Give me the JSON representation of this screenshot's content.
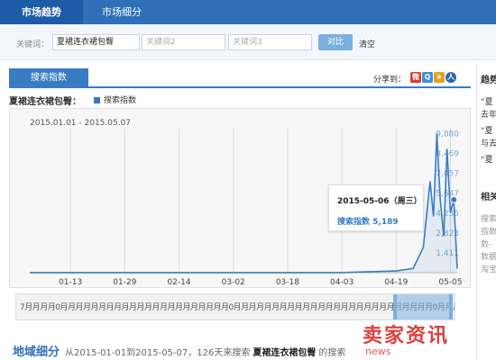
{
  "nav": {
    "tabs": [
      {
        "label": "市场趋势"
      },
      {
        "label": "市场细分"
      }
    ]
  },
  "keywords": {
    "label": "关键词：",
    "kw1_value": "夏裙连衣裙包臀",
    "kw2_placeholder": "关键词2",
    "kw3_placeholder": "关键词3",
    "compare_label": "对比",
    "clear_label": "清空"
  },
  "panel": {
    "tab_label": "搜索指数",
    "share_label": "分享到："
  },
  "chart_header": {
    "title": "夏裙连衣裙包臀：",
    "legend": "搜索指数",
    "date_range": "2015.01.01 - 2015.05.07"
  },
  "tooltip": {
    "date": "2015-05-06（周三）",
    "label_value": "搜索指数 5,189"
  },
  "navigator": {
    "cells": "7月月月月0月月月月月月月月月月月月月月月月月月月月月月0月月月月月月月月月月月月月月月月月月月月月月月月月月0月月月月月月月"
  },
  "bottom": {
    "heading": "地域细分",
    "prefix": "从2015-01-01到2015-05-07，126天来搜索",
    "keyword": "夏裙连衣裙包臀",
    "suffix": "的搜索"
  },
  "watermark": {
    "main": "卖家资讯",
    "sub": "news"
  },
  "sidebar": {
    "t1": "趋势",
    "s1": "“夏",
    "s2": "去年",
    "s3": "“夏",
    "s4": "与去",
    "s5": "“夏",
    "t2": "相关",
    "g1": "搜索",
    "g2": "指数",
    "g3": "数-",
    "g4": "数据",
    "g5": "淘宝"
  },
  "chart_data": {
    "type": "line",
    "yticks": [
      "1,411",
      "2,823",
      "4,235",
      "5,647",
      "7,057",
      "8,469",
      "9,880"
    ],
    "xticks": [
      "01-13",
      "01-29",
      "02-14",
      "03-02",
      "03-18",
      "04-03",
      "04-19",
      "05-05"
    ],
    "ylim": [
      0,
      11000
    ],
    "x": [
      "2015-01-01",
      "2015-01-13",
      "2015-01-29",
      "2015-02-14",
      "2015-03-02",
      "2015-03-18",
      "2015-04-03",
      "2015-04-19",
      "2015-04-24",
      "2015-04-27",
      "2015-04-29",
      "2015-04-30",
      "2015-05-01",
      "2015-05-02",
      "2015-05-03",
      "2015-05-04",
      "2015-05-05",
      "2015-05-06",
      "2015-05-07"
    ],
    "series": [
      {
        "values": [
          5,
          5,
          5,
          5,
          5,
          5,
          5,
          120,
          300,
          1800,
          6500,
          4000,
          9880,
          5200,
          2600,
          8800,
          4300,
          5189,
          300
        ]
      }
    ],
    "grid": "vertical",
    "line_color": "#3a7cc4",
    "tooltip_date": "2015-05-06"
  }
}
